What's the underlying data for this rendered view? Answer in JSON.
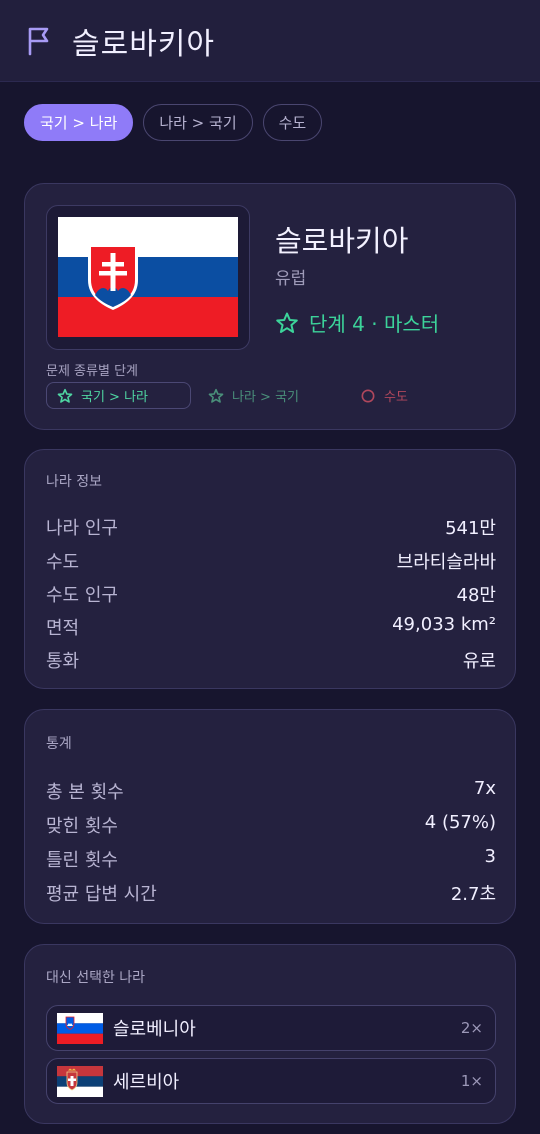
{
  "header": {
    "title": "슬로바키아",
    "icon": "flag-icon"
  },
  "tabs": [
    {
      "label": "국기 > 나라",
      "active": true
    },
    {
      "label": "나라 > 국기",
      "active": false
    },
    {
      "label": "수도",
      "active": false
    }
  ],
  "country": {
    "name": "슬로바키아",
    "continent": "유럽",
    "level": "단계 4 · 마스터",
    "levels_label": "문제 종류별 단계",
    "levels": [
      {
        "label": "국기 > 나라",
        "icon": "star-icon"
      },
      {
        "label": "나라 > 국기",
        "icon": "star-icon"
      },
      {
        "label": "수도",
        "icon": "circle-icon"
      }
    ]
  },
  "info": {
    "title": "나라 정보",
    "rows": [
      {
        "k": "나라 인구",
        "v": "541만"
      },
      {
        "k": "수도",
        "v": "브라티슬라바"
      },
      {
        "k": "수도 인구",
        "v": "48만"
      },
      {
        "k": "면적",
        "v": "49,033 km²"
      },
      {
        "k": "통화",
        "v": "유로"
      }
    ]
  },
  "stats": {
    "title": "통계",
    "rows": [
      {
        "k": "총 본 횟수",
        "v": "7x"
      },
      {
        "k": "맞힌 횟수",
        "v": "4 (57%)"
      },
      {
        "k": "틀린 횟수",
        "v": "3"
      },
      {
        "k": "평균 답변 시간",
        "v": "2.7초"
      }
    ]
  },
  "picked": {
    "title": "대신 선택한 나라",
    "items": [
      {
        "name": "슬로베니아",
        "count": "2×"
      },
      {
        "name": "세르비아",
        "count": "1×"
      }
    ]
  },
  "colors": {
    "accent": "#8f7bf8",
    "mastered": "#3cd39a",
    "background": "#17152e"
  }
}
